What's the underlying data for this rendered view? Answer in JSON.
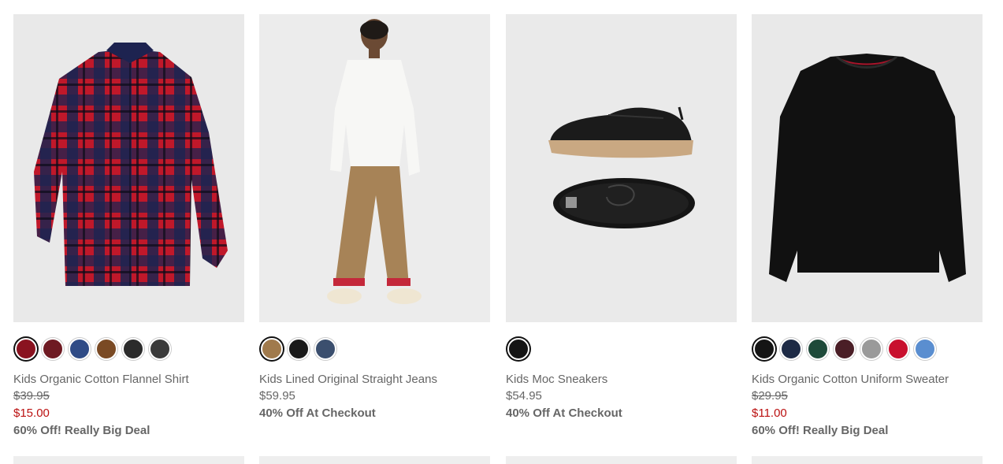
{
  "products": [
    {
      "image_alt": "Kids Organic Cotton Flannel Shirt",
      "name": "Kids Organic Cotton Flannel Shirt",
      "original_price": "$39.95",
      "sale_price": "$15.00",
      "price": null,
      "promo": "60% Off! Really Big Deal",
      "swatches": [
        {
          "color": "#8a1320",
          "selected": true
        },
        {
          "color": "#6e1a22",
          "selected": false
        },
        {
          "color": "#2f4b86",
          "selected": false
        },
        {
          "color": "#7a4a24",
          "selected": false
        },
        {
          "color": "#2b2b2b",
          "selected": false
        },
        {
          "color": "#3a3a3a",
          "selected": false
        }
      ]
    },
    {
      "image_alt": "Kids Lined Original Straight Jeans",
      "name": "Kids Lined Original Straight Jeans",
      "original_price": null,
      "sale_price": null,
      "price": "$59.95",
      "promo": "40% Off At Checkout",
      "swatches": [
        {
          "color": "#a07a4c",
          "selected": true
        },
        {
          "color": "#1a1a1a",
          "selected": false
        },
        {
          "color": "#3b4f6e",
          "selected": false
        }
      ]
    },
    {
      "image_alt": "Kids Moc Sneakers",
      "name": "Kids Moc Sneakers",
      "original_price": null,
      "sale_price": null,
      "price": "$54.95",
      "promo": "40% Off At Checkout",
      "swatches": [
        {
          "color": "#151515",
          "selected": true
        }
      ]
    },
    {
      "image_alt": "Kids Organic Cotton Uniform Sweater",
      "name": "Kids Organic Cotton Uniform Sweater",
      "original_price": "$29.95",
      "sale_price": "$11.00",
      "price": null,
      "promo": "60% Off! Really Big Deal",
      "swatches": [
        {
          "color": "#151515",
          "selected": true
        },
        {
          "color": "#1d2a45",
          "selected": false
        },
        {
          "color": "#1e4a3a",
          "selected": false
        },
        {
          "color": "#4a1e26",
          "selected": false
        },
        {
          "color": "#9a9a9a",
          "selected": false
        },
        {
          "color": "#c8102e",
          "selected": false
        },
        {
          "color": "#5a8ed0",
          "selected": false
        }
      ]
    }
  ]
}
